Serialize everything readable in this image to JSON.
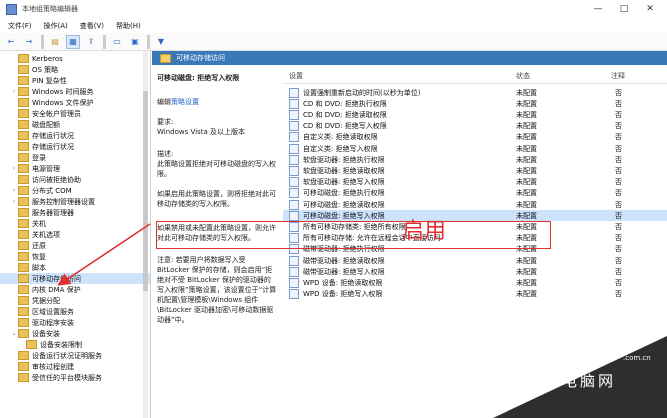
{
  "window": {
    "title": "本地组策略编辑器",
    "controls": [
      "—",
      "□",
      "✕"
    ]
  },
  "menu": [
    "文件(F)",
    "操作(A)",
    "查看(V)",
    "帮助(H)"
  ],
  "toolbar": [
    "back-arrow-icon",
    "forward-arrow-icon",
    "up-folder-icon",
    "show-tree-icon",
    "export-icon",
    "properties-icon",
    "help-icon",
    "filter-icon"
  ],
  "tree": {
    "items": [
      {
        "label": "Kerberos",
        "caret": ""
      },
      {
        "label": "OS 策略",
        "caret": ""
      },
      {
        "label": "PIN 复杂性",
        "caret": ""
      },
      {
        "label": "Windows 时间服务",
        "caret": "›"
      },
      {
        "label": "Windows 文件保护",
        "caret": ""
      },
      {
        "label": "安全帐户管理员",
        "caret": ""
      },
      {
        "label": "磁盘配额",
        "caret": ""
      },
      {
        "label": "存储运行状况",
        "caret": ""
      },
      {
        "label": "存储运行状况",
        "caret": ""
      },
      {
        "label": "登录",
        "caret": ""
      },
      {
        "label": "电源管理",
        "caret": "›"
      },
      {
        "label": "访问被拒绝协助",
        "caret": ""
      },
      {
        "label": "分布式 COM",
        "caret": "›"
      },
      {
        "label": "服务控制管理器设置",
        "caret": "›"
      },
      {
        "label": "服务器管理器",
        "caret": ""
      },
      {
        "label": "关机",
        "caret": ""
      },
      {
        "label": "关机选项",
        "caret": ""
      },
      {
        "label": "还原",
        "caret": ""
      },
      {
        "label": "恢复",
        "caret": ""
      },
      {
        "label": "脚本",
        "caret": ""
      },
      {
        "label": "可移动存储访问",
        "caret": ""
      },
      {
        "label": "内核 DMA 保护",
        "caret": ""
      },
      {
        "label": "凭据分配",
        "caret": ""
      },
      {
        "label": "区域设置服务",
        "caret": ""
      },
      {
        "label": "驱动程序安装",
        "caret": ""
      },
      {
        "label": "设备安装",
        "caret": "⌄"
      },
      {
        "label": "设备安装限制",
        "caret": ""
      },
      {
        "label": "设备运行状况证明服务",
        "caret": ""
      },
      {
        "label": "审核过程创建",
        "caret": ""
      },
      {
        "label": "受信任的平台模块服务",
        "caret": ""
      }
    ],
    "selected_index": 20
  },
  "content": {
    "header": "可移动存储访问",
    "policy_title": "可移动磁盘: 拒绝写入权限",
    "edit_prefix": "编辑",
    "edit_link": "策略设置",
    "req_label": "要求:",
    "req_value": "Windows Vista 及以上版本",
    "desc_label": "描述:",
    "desc_1": "此策略设置拒绝对可移动磁盘的写入权限。",
    "desc_2": "如果启用此策略设置，则将拒绝对此可移动存储类的写入权限。",
    "desc_3": "如果禁用或未配置此策略设置，则允许对此可移动存储类的写入权限。",
    "desc_4": "注意: 若要用户将数据写入受 BitLocker 保护的存储，则会启用“拒绝对不受 BitLocker 保护的驱动器的写入权限”策略设置，该设置位于“计算机配置\\管理模板\\Windows 组件\\BitLocker 驱动器加密\\可移动数据驱动器”中。"
  },
  "grid": {
    "col_setting": "设置",
    "col_state": "状态",
    "col_note": "注释",
    "rows": [
      {
        "name": "设置强制重新启动的时间(以秒为单位)",
        "state": "未配置",
        "note": "否"
      },
      {
        "name": "CD 和 DVD: 拒绝执行权限",
        "state": "未配置",
        "note": "否"
      },
      {
        "name": "CD 和 DVD: 拒绝读取权限",
        "state": "未配置",
        "note": "否"
      },
      {
        "name": "CD 和 DVD: 拒绝写入权限",
        "state": "未配置",
        "note": "否"
      },
      {
        "name": "自定义类: 拒绝读取权限",
        "state": "未配置",
        "note": "否"
      },
      {
        "name": "自定义类: 拒绝写入权限",
        "state": "未配置",
        "note": "否"
      },
      {
        "name": "软盘驱动器: 拒绝执行权限",
        "state": "未配置",
        "note": "否"
      },
      {
        "name": "软盘驱动器: 拒绝读取权限",
        "state": "未配置",
        "note": "否"
      },
      {
        "name": "软盘驱动器: 拒绝写入权限",
        "state": "未配置",
        "note": "否"
      },
      {
        "name": "可移动磁盘: 拒绝执行权限",
        "state": "未配置",
        "note": "否"
      },
      {
        "name": "可移动磁盘: 拒绝读取权限",
        "state": "未配置",
        "note": "否"
      },
      {
        "name": "可移动磁盘: 拒绝写入权限",
        "state": "未配置",
        "note": "否"
      },
      {
        "name": "所有可移动存储类: 拒绝所有权限",
        "state": "未配置",
        "note": "否"
      },
      {
        "name": "所有可移动存储: 允许在远程会话中直接访问",
        "state": "未配置",
        "note": "否"
      },
      {
        "name": "磁带驱动器: 拒绝执行权限",
        "state": "未配置",
        "note": "否"
      },
      {
        "name": "磁带驱动器: 拒绝读取权限",
        "state": "未配置",
        "note": "否"
      },
      {
        "name": "磁带驱动器: 拒绝写入权限",
        "state": "未配置",
        "note": "否"
      },
      {
        "name": "WPD 设备: 拒绝读取权限",
        "state": "未配置",
        "note": "否"
      },
      {
        "name": "WPD 设备: 拒绝写入权限",
        "state": "未配置",
        "note": "否"
      }
    ],
    "selected_index": 11
  },
  "annotation": {
    "label": "启用",
    "color": "#e03030"
  },
  "watermark": {
    "brand": "PConline",
    "dot": ".com.cn",
    "sub": "太平洋电脑网"
  },
  "colors": {
    "header_bar": "#3a78b8",
    "selection": "#cce3fb",
    "accent_red": "#e03030"
  }
}
